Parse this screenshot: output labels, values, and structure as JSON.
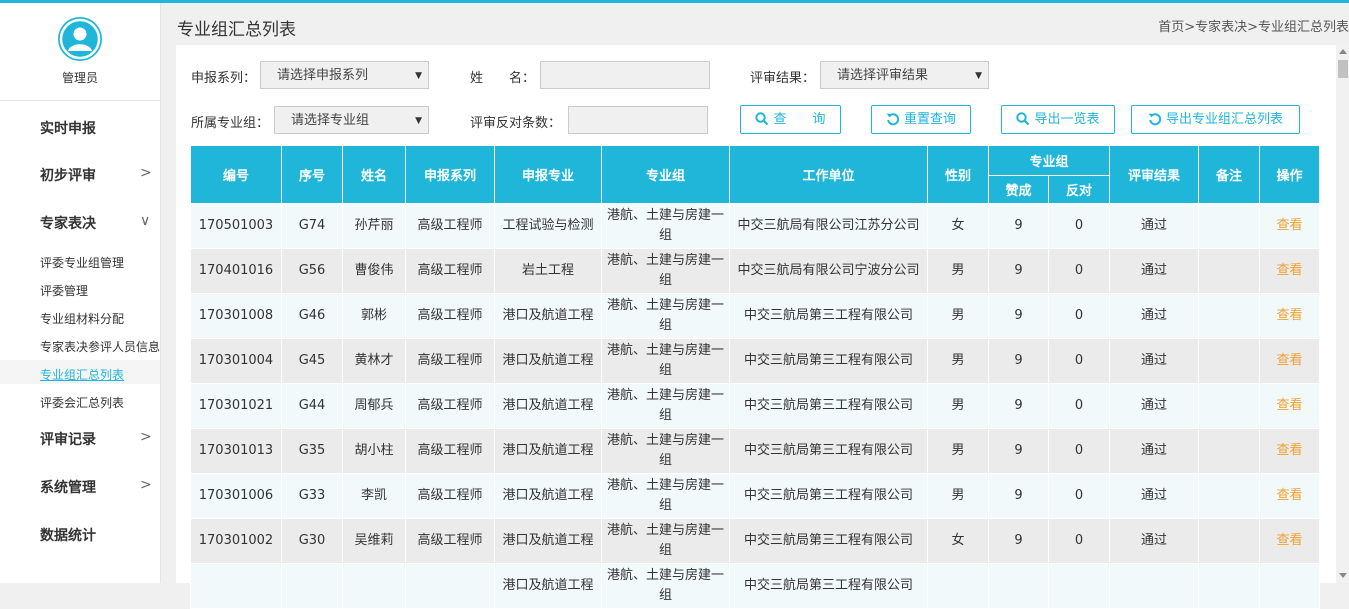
{
  "sidebar": {
    "role": "管理员",
    "items": [
      {
        "label": "实时申报",
        "arrow": ""
      },
      {
        "label": "初步评审",
        "arrow": ">"
      },
      {
        "label": "专家表决",
        "arrow": "∨"
      },
      {
        "label": "评审记录",
        "arrow": ">"
      },
      {
        "label": "系统管理",
        "arrow": ">"
      },
      {
        "label": "数据统计",
        "arrow": ""
      }
    ],
    "subitems": [
      "评委专业组管理",
      "评委管理",
      "专业组材料分配",
      "专家表决参评人员信息",
      "专业组汇总列表",
      "评委会汇总列表"
    ],
    "active_subitem": "专业组汇总列表"
  },
  "page": {
    "title": "专业组汇总列表",
    "breadcrumb": "首页>专家表决>专业组汇总列表"
  },
  "filters": {
    "series_label": "申报系列：",
    "series_select": "请选择申报系列",
    "name_label": "姓　　名：",
    "name_value": "",
    "result_label": "评审结果：",
    "result_select": "请选择评审结果",
    "group_label": "所属专业组：",
    "group_select": "请选择专业组",
    "against_label": "评审反对条数：",
    "against_value": ""
  },
  "buttons": {
    "query": "查　　询",
    "reset": "重置查询",
    "export_list": "导出一览表",
    "export_summary": "导出专业组汇总列表"
  },
  "table": {
    "headers": {
      "id": "编号",
      "seq": "序号",
      "name": "姓名",
      "series": "申报系列",
      "major": "申报专业",
      "group": "专业组",
      "unit": "工作单位",
      "gender": "性别",
      "group_vote": "专业组",
      "yes": "赞成",
      "no": "反对",
      "result": "评审结果",
      "remark": "备注",
      "op": "操作"
    },
    "rows": [
      {
        "id": "170501003",
        "seq": "G74",
        "name": "孙芹丽",
        "series": "高级工程师",
        "major": "工程试验与检测",
        "group": "港航、土建与房建一组",
        "unit": "中交三航局有限公司江苏分公司",
        "gender": "女",
        "yes": "9",
        "no": "0",
        "result": "通过",
        "remark": "",
        "op": "查看"
      },
      {
        "id": "170401016",
        "seq": "G56",
        "name": "曹俊伟",
        "series": "高级工程师",
        "major": "岩土工程",
        "group": "港航、土建与房建一组",
        "unit": "中交三航局有限公司宁波分公司",
        "gender": "男",
        "yes": "9",
        "no": "0",
        "result": "通过",
        "remark": "",
        "op": "查看"
      },
      {
        "id": "170301008",
        "seq": "G46",
        "name": "郭彬",
        "series": "高级工程师",
        "major": "港口及航道工程",
        "group": "港航、土建与房建一组",
        "unit": "中交三航局第三工程有限公司",
        "gender": "男",
        "yes": "9",
        "no": "0",
        "result": "通过",
        "remark": "",
        "op": "查看"
      },
      {
        "id": "170301004",
        "seq": "G45",
        "name": "黄林才",
        "series": "高级工程师",
        "major": "港口及航道工程",
        "group": "港航、土建与房建一组",
        "unit": "中交三航局第三工程有限公司",
        "gender": "男",
        "yes": "9",
        "no": "0",
        "result": "通过",
        "remark": "",
        "op": "查看"
      },
      {
        "id": "170301021",
        "seq": "G44",
        "name": "周郁兵",
        "series": "高级工程师",
        "major": "港口及航道工程",
        "group": "港航、土建与房建一组",
        "unit": "中交三航局第三工程有限公司",
        "gender": "男",
        "yes": "9",
        "no": "0",
        "result": "通过",
        "remark": "",
        "op": "查看"
      },
      {
        "id": "170301013",
        "seq": "G35",
        "name": "胡小柱",
        "series": "高级工程师",
        "major": "港口及航道工程",
        "group": "港航、土建与房建一组",
        "unit": "中交三航局第三工程有限公司",
        "gender": "男",
        "yes": "9",
        "no": "0",
        "result": "通过",
        "remark": "",
        "op": "查看"
      },
      {
        "id": "170301006",
        "seq": "G33",
        "name": "李凯",
        "series": "高级工程师",
        "major": "港口及航道工程",
        "group": "港航、土建与房建一组",
        "unit": "中交三航局第三工程有限公司",
        "gender": "男",
        "yes": "9",
        "no": "0",
        "result": "通过",
        "remark": "",
        "op": "查看"
      },
      {
        "id": "170301002",
        "seq": "G30",
        "name": "吴维莉",
        "series": "高级工程师",
        "major": "港口及航道工程",
        "group": "港航、土建与房建一组",
        "unit": "中交三航局第三工程有限公司",
        "gender": "女",
        "yes": "9",
        "no": "0",
        "result": "通过",
        "remark": "",
        "op": "查看"
      },
      {
        "id": "",
        "seq": "",
        "name": "",
        "series": "",
        "major": "港口及航道工程",
        "group": "港航、土建与房建一组",
        "unit": "中交三航局第三工程有限公司",
        "gender": "",
        "yes": "",
        "no": "",
        "result": "",
        "remark": "",
        "op": ""
      }
    ]
  },
  "colors": {
    "accent": "#1fb6d9",
    "link_orange": "#f0a032"
  }
}
